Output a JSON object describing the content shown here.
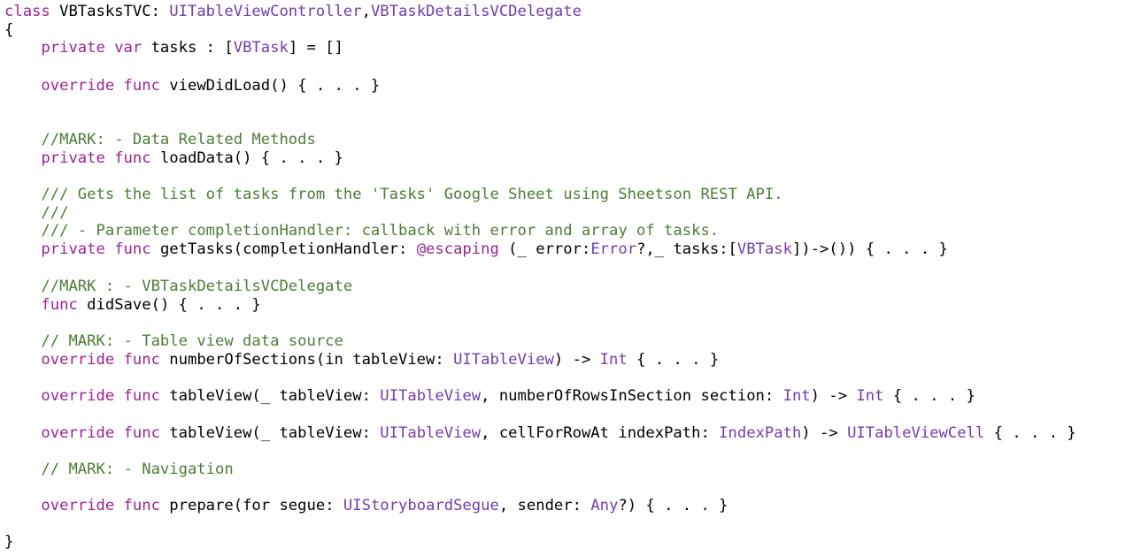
{
  "editor": {
    "colors": {
      "keyword": "#9b2393",
      "type": "#703daa",
      "comment": "#4d7d36",
      "plain": "#000000",
      "background": "#ffffff"
    },
    "lines": [
      [
        {
          "t": "kw",
          "s": "class"
        },
        {
          "t": "plain",
          "s": " VBTasksTVC: "
        },
        {
          "t": "type",
          "s": "UITableViewController"
        },
        {
          "t": "plain",
          "s": ","
        },
        {
          "t": "type",
          "s": "VBTaskDetailsVCDelegate"
        }
      ],
      [
        {
          "t": "plain",
          "s": "{"
        }
      ],
      [
        {
          "t": "plain",
          "s": "    "
        },
        {
          "t": "kw",
          "s": "private var"
        },
        {
          "t": "plain",
          "s": " tasks : ["
        },
        {
          "t": "type",
          "s": "VBTask"
        },
        {
          "t": "plain",
          "s": "] = []"
        }
      ],
      [
        {
          "t": "plain",
          "s": "    "
        },
        {
          "t": "kw",
          "s": "override func"
        },
        {
          "t": "plain",
          "s": " viewDidLoad() { . . . }"
        }
      ],
      [
        {
          "t": "plain",
          "s": "    "
        },
        {
          "t": "comment",
          "s": "//MARK: - Data Related Methods"
        }
      ],
      [
        {
          "t": "plain",
          "s": "    "
        },
        {
          "t": "kw",
          "s": "private func"
        },
        {
          "t": "plain",
          "s": " loadData() { . . . }"
        }
      ],
      [
        {
          "t": "plain",
          "s": "    "
        },
        {
          "t": "comment",
          "s": "/// Gets the list of tasks from the 'Tasks' Google Sheet using Sheetson REST API."
        }
      ],
      [
        {
          "t": "plain",
          "s": "    "
        },
        {
          "t": "comment",
          "s": "///"
        }
      ],
      [
        {
          "t": "plain",
          "s": "    "
        },
        {
          "t": "comment",
          "s": "/// - Parameter completionHandler: callback with error and array of tasks."
        }
      ],
      [
        {
          "t": "plain",
          "s": "    "
        },
        {
          "t": "kw",
          "s": "private func"
        },
        {
          "t": "plain",
          "s": " getTasks(completionHandler: "
        },
        {
          "t": "kw",
          "s": "@escaping"
        },
        {
          "t": "plain",
          "s": " (_ error:"
        },
        {
          "t": "type",
          "s": "Error"
        },
        {
          "t": "plain",
          "s": "?,_ tasks:["
        },
        {
          "t": "type",
          "s": "VBTask"
        },
        {
          "t": "plain",
          "s": "])->()) { . . . }"
        }
      ],
      [
        {
          "t": "plain",
          "s": "    "
        },
        {
          "t": "comment",
          "s": "//MARK : - VBTaskDetailsVCDelegate"
        }
      ],
      [
        {
          "t": "plain",
          "s": "    "
        },
        {
          "t": "kw",
          "s": "func"
        },
        {
          "t": "plain",
          "s": " didSave() { . . . }"
        }
      ],
      [
        {
          "t": "plain",
          "s": "    "
        },
        {
          "t": "comment",
          "s": "// MARK: - Table view data source"
        }
      ],
      [
        {
          "t": "plain",
          "s": "    "
        },
        {
          "t": "kw",
          "s": "override func"
        },
        {
          "t": "plain",
          "s": " numberOfSections(in tableView: "
        },
        {
          "t": "type",
          "s": "UITableView"
        },
        {
          "t": "plain",
          "s": ") -> "
        },
        {
          "t": "type",
          "s": "Int"
        },
        {
          "t": "plain",
          "s": " { . . . }"
        }
      ],
      [
        {
          "t": "plain",
          "s": "    "
        },
        {
          "t": "kw",
          "s": "override func"
        },
        {
          "t": "plain",
          "s": " tableView(_ tableView: "
        },
        {
          "t": "type",
          "s": "UITableView"
        },
        {
          "t": "plain",
          "s": ", numberOfRowsInSection section: "
        },
        {
          "t": "type",
          "s": "Int"
        },
        {
          "t": "plain",
          "s": ") -> "
        },
        {
          "t": "type",
          "s": "Int"
        },
        {
          "t": "plain",
          "s": " { . . . }"
        }
      ],
      [
        {
          "t": "plain",
          "s": "    "
        },
        {
          "t": "kw",
          "s": "override func"
        },
        {
          "t": "plain",
          "s": " tableView(_ tableView: "
        },
        {
          "t": "type",
          "s": "UITableView"
        },
        {
          "t": "plain",
          "s": ", cellForRowAt indexPath: "
        },
        {
          "t": "type",
          "s": "IndexPath"
        },
        {
          "t": "plain",
          "s": ") -> "
        },
        {
          "t": "type",
          "s": "UITableViewCell"
        },
        {
          "t": "plain",
          "s": " { . . . }"
        }
      ],
      [
        {
          "t": "plain",
          "s": "    "
        },
        {
          "t": "comment",
          "s": "// MARK: - Navigation"
        }
      ],
      [
        {
          "t": "plain",
          "s": "    "
        },
        {
          "t": "kw",
          "s": "override func"
        },
        {
          "t": "plain",
          "s": " prepare(for segue: "
        },
        {
          "t": "type",
          "s": "UIStoryboardSegue"
        },
        {
          "t": "plain",
          "s": ", sender: "
        },
        {
          "t": "type",
          "s": "Any"
        },
        {
          "t": "plain",
          "s": "?) { . . . }"
        }
      ],
      [
        {
          "t": "plain",
          "s": "}"
        }
      ]
    ]
  }
}
